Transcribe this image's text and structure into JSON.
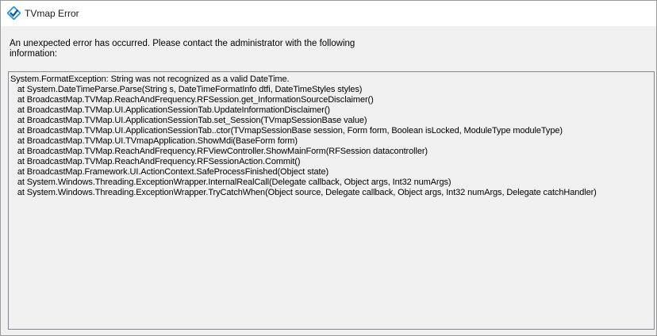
{
  "window": {
    "title": "TVmap Error",
    "app_icon": "tvmap-logo-icon"
  },
  "message": {
    "text": "An unexpected error has occurred.  Please contact the administrator with the following\ninformation:"
  },
  "details": {
    "lines": [
      "System.FormatException: String was not recognized as a valid DateTime.",
      "   at System.DateTimeParse.Parse(String s, DateTimeFormatInfo dtfi, DateTimeStyles styles)",
      "   at BroadcastMap.TVMap.ReachAndFrequency.RFSession.get_InformationSourceDisclaimer()",
      "   at BroadcastMap.TVMap.UI.ApplicationSessionTab.UpdateInformationDisclaimer()",
      "   at BroadcastMap.TVMap.UI.ApplicationSessionTab.set_Session(TVmapSessionBase value)",
      "   at BroadcastMap.TVMap.UI.ApplicationSessionTab..ctor(TVmapSessionBase session, Form form, Boolean isLocked, ModuleType moduleType)",
      "   at BroadcastMap.TVMap.UI.TVmapApplication.ShowMdi(BaseForm form)",
      "   at BroadcastMap.TVMap.ReachAndFrequency.RFViewController.ShowMainForm(RFSession datacontroller)",
      "   at BroadcastMap.TVMap.ReachAndFrequency.RFSessionAction.Commit()",
      "   at BroadcastMap.Framework.UI.ActionContext.SafeProcessFinished(Object state)",
      "   at System.Windows.Threading.ExceptionWrapper.InternalRealCall(Delegate callback, Object args, Int32 numArgs)",
      "   at System.Windows.Threading.ExceptionWrapper.TryCatchWhen(Object source, Delegate callback, Object args, Int32 numArgs, Delegate catchHandler)"
    ]
  },
  "colors": {
    "titlebar_bg": "#ffffff",
    "window_bg": "#f0f0f0",
    "icon_blue": "#1e90d8",
    "icon_dark": "#0b5ea8"
  }
}
